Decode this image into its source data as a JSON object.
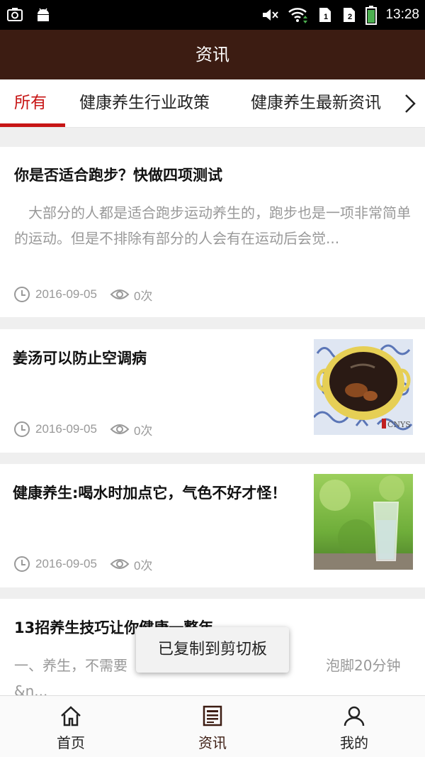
{
  "status_bar": {
    "time": "13:28",
    "left_icons": [
      "screenshot-icon",
      "android-icon"
    ],
    "right_icons": [
      "mute-icon",
      "wifi-icon",
      "sim1-icon",
      "sim2-icon",
      "battery-icon"
    ]
  },
  "header": {
    "title": "资讯"
  },
  "tabs": [
    {
      "label": "所有",
      "active": true
    },
    {
      "label": "健康养生行业政策",
      "active": false
    },
    {
      "label": "健康养生最新资讯",
      "active": false
    }
  ],
  "articles": [
    {
      "title": "你是否适合跑步？快做四项测试",
      "desc": "　大部分的人都是适合跑步运动养生的，跑步也是一项非常简单的运动。但是不排除有部分的人会有在运动后会觉...",
      "date": "2016-09-05",
      "views": "0次"
    },
    {
      "title": "姜汤可以防止空调病",
      "date": "2016-09-05",
      "views": "0次",
      "thumb_watermark": "CNYS"
    },
    {
      "title": "健康养生:喝水时加点它，气色不好才怪！",
      "date": "2016-09-05",
      "views": "0次"
    },
    {
      "title": "13招养生技巧让你健康一整年",
      "desc": "一、养生，不需要　　　　　　　　　　　　　　泡脚20分钟&n..."
    }
  ],
  "toast": {
    "text": "已复制到剪切板"
  },
  "bottom_nav": [
    {
      "label": "首页",
      "icon": "home-icon"
    },
    {
      "label": "资讯",
      "icon": "news-icon"
    },
    {
      "label": "我的",
      "icon": "user-icon"
    }
  ],
  "colors": {
    "header_bg": "#3c1c12",
    "accent": "#c71515"
  }
}
